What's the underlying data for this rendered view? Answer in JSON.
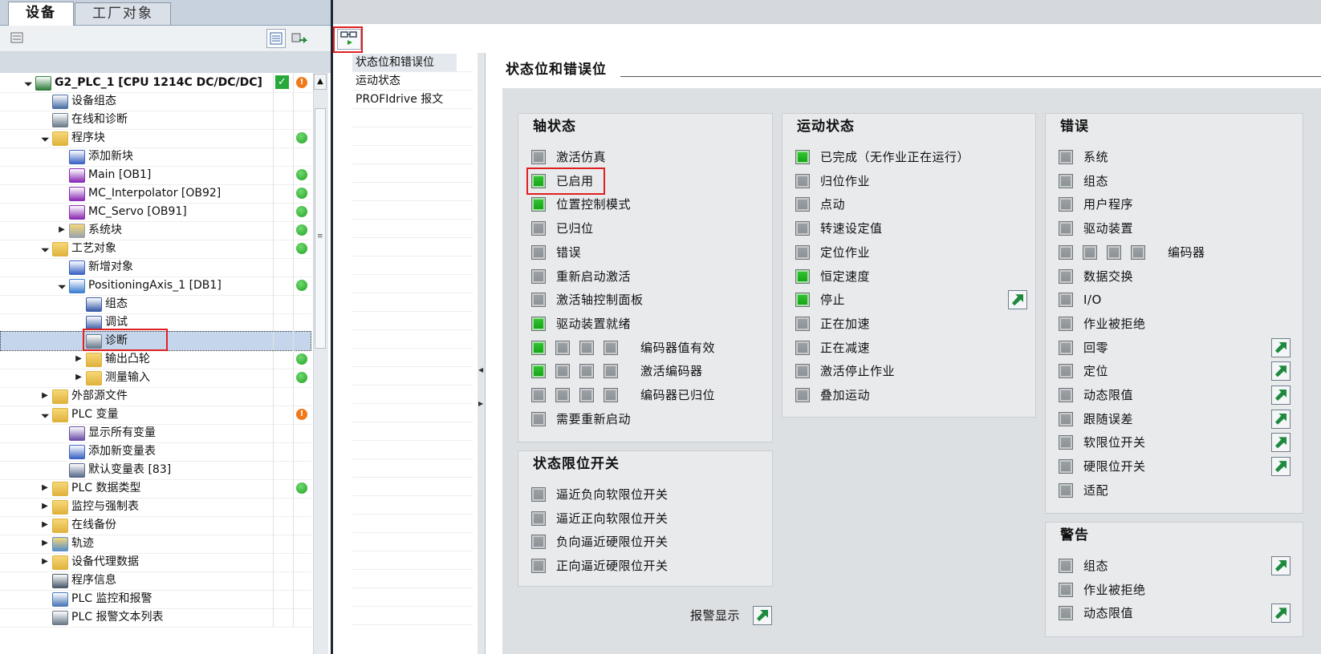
{
  "left_tabs": [
    "设备",
    "工厂对象"
  ],
  "tree": [
    {
      "label": "G2_PLC_1 [CPU 1214C DC/DC/DC]",
      "level": 0,
      "expand": "open",
      "icon": "plc-icon",
      "bold": true,
      "check": true,
      "status": "warn"
    },
    {
      "label": "设备组态",
      "level": 1,
      "expand": "none",
      "icon": "device-config-icon",
      "status": "none"
    },
    {
      "label": "在线和诊断",
      "level": 1,
      "expand": "none",
      "icon": "online-diagnostics-icon",
      "status": "none"
    },
    {
      "label": "程序块",
      "level": 1,
      "expand": "open",
      "icon": "folder-icon",
      "status": "ok"
    },
    {
      "label": "添加新块",
      "level": 2,
      "expand": "none",
      "icon": "add-block-icon",
      "status": "none"
    },
    {
      "label": "Main [OB1]",
      "level": 2,
      "expand": "none",
      "icon": "ob-block-icon",
      "status": "ok"
    },
    {
      "label": "MC_Interpolator [OB92]",
      "level": 2,
      "expand": "none",
      "icon": "ob-block-icon",
      "status": "ok"
    },
    {
      "label": "MC_Servo [OB91]",
      "level": 2,
      "expand": "none",
      "icon": "ob-block-icon",
      "status": "ok"
    },
    {
      "label": "系统块",
      "level": 2,
      "expand": "closed",
      "icon": "system-folder-icon",
      "status": "ok"
    },
    {
      "label": "工艺对象",
      "level": 1,
      "expand": "open",
      "icon": "tech-folder-icon",
      "status": "ok"
    },
    {
      "label": "新增对象",
      "level": 2,
      "expand": "none",
      "icon": "add-object-icon",
      "status": "none"
    },
    {
      "label": "PositioningAxis_1 [DB1]",
      "level": 2,
      "expand": "open",
      "icon": "axis-icon",
      "status": "ok"
    },
    {
      "label": "组态",
      "level": 3,
      "expand": "none",
      "icon": "config-icon",
      "status": "none"
    },
    {
      "label": "调试",
      "level": 3,
      "expand": "none",
      "icon": "commissioning-icon",
      "status": "none"
    },
    {
      "label": "诊断",
      "level": 3,
      "expand": "none",
      "icon": "diagnostics-icon",
      "status": "none",
      "selected": true
    },
    {
      "label": "输出凸轮",
      "level": 3,
      "expand": "closed",
      "icon": "tech-folder-icon",
      "status": "ok"
    },
    {
      "label": "测量输入",
      "level": 3,
      "expand": "closed",
      "icon": "tech-folder-icon",
      "status": "ok"
    },
    {
      "label": "外部源文件",
      "level": 1,
      "expand": "closed",
      "icon": "source-folder-icon",
      "status": "none"
    },
    {
      "label": "PLC 变量",
      "level": 1,
      "expand": "open",
      "icon": "tags-folder-icon",
      "status": "warn"
    },
    {
      "label": "显示所有变量",
      "level": 2,
      "expand": "none",
      "icon": "show-tags-icon",
      "status": "none"
    },
    {
      "label": "添加新变量表",
      "level": 2,
      "expand": "none",
      "icon": "add-tag-table-icon",
      "status": "none"
    },
    {
      "label": "默认变量表 [83]",
      "level": 2,
      "expand": "none",
      "icon": "tag-table-icon",
      "status": "none"
    },
    {
      "label": "PLC 数据类型",
      "level": 1,
      "expand": "closed",
      "icon": "datatype-folder-icon",
      "status": "ok"
    },
    {
      "label": "监控与强制表",
      "level": 1,
      "expand": "closed",
      "icon": "watch-folder-icon",
      "status": "none"
    },
    {
      "label": "在线备份",
      "level": 1,
      "expand": "closed",
      "icon": "backup-folder-icon",
      "status": "none"
    },
    {
      "label": "轨迹",
      "level": 1,
      "expand": "closed",
      "icon": "trace-folder-icon",
      "status": "none"
    },
    {
      "label": "设备代理数据",
      "level": 1,
      "expand": "closed",
      "icon": "proxy-folder-icon",
      "status": "none"
    },
    {
      "label": "程序信息",
      "level": 1,
      "expand": "none",
      "icon": "program-info-icon",
      "status": "none"
    },
    {
      "label": "PLC 监控和报警",
      "level": 1,
      "expand": "none",
      "icon": "alarm-icon",
      "status": "none"
    },
    {
      "label": "PLC 报警文本列表",
      "level": 1,
      "expand": "none",
      "icon": "text-list-icon",
      "status": "none"
    }
  ],
  "nav": [
    {
      "label": "状态位和错误位",
      "active": true
    },
    {
      "label": "运动状态",
      "active": false
    },
    {
      "label": "PROFIdrive 报文",
      "active": false
    }
  ],
  "content_title": "状态位和错误位",
  "groups": {
    "axis_status": {
      "title": "轴状态",
      "rows": [
        {
          "label": "激活仿真",
          "leds": [
            "off"
          ]
        },
        {
          "label": "已启用",
          "leds": [
            "on"
          ]
        },
        {
          "label": "位置控制模式",
          "leds": [
            "on"
          ]
        },
        {
          "label": "已归位",
          "leds": [
            "off"
          ]
        },
        {
          "label": "错误",
          "leds": [
            "off"
          ]
        },
        {
          "label": "重新启动激活",
          "leds": [
            "off"
          ]
        },
        {
          "label": "激活轴控制面板",
          "leds": [
            "off"
          ]
        },
        {
          "label": "驱动装置就绪",
          "leds": [
            "on"
          ]
        },
        {
          "label": "编码器值有效",
          "leds": [
            "on",
            "off",
            "off",
            "off"
          ]
        },
        {
          "label": "激活编码器",
          "leds": [
            "on",
            "off",
            "off",
            "off"
          ]
        },
        {
          "label": "编码器已归位",
          "leds": [
            "off",
            "off",
            "off",
            "off"
          ]
        },
        {
          "label": "需要重新启动",
          "leds": [
            "off"
          ]
        }
      ]
    },
    "limit_switch": {
      "title": "状态限位开关",
      "rows": [
        {
          "label": "逼近负向软限位开关",
          "leds": [
            "off"
          ]
        },
        {
          "label": "逼近正向软限位开关",
          "leds": [
            "off"
          ]
        },
        {
          "label": "负向逼近硬限位开关",
          "leds": [
            "off"
          ]
        },
        {
          "label": "正向逼近硬限位开关",
          "leds": [
            "off"
          ]
        }
      ]
    },
    "motion_status": {
      "title": "运动状态",
      "rows": [
        {
          "label": "已完成（无作业正在运行）",
          "leds": [
            "on"
          ]
        },
        {
          "label": "归位作业",
          "leds": [
            "off"
          ]
        },
        {
          "label": "点动",
          "leds": [
            "off"
          ]
        },
        {
          "label": "转速设定值",
          "leds": [
            "off"
          ]
        },
        {
          "label": "定位作业",
          "leds": [
            "off"
          ]
        },
        {
          "label": "恒定速度",
          "leds": [
            "on"
          ]
        },
        {
          "label": "停止",
          "leds": [
            "on"
          ],
          "jump": true
        },
        {
          "label": "正在加速",
          "leds": [
            "off"
          ]
        },
        {
          "label": "正在减速",
          "leds": [
            "off"
          ]
        },
        {
          "label": "激活停止作业",
          "leds": [
            "off"
          ]
        },
        {
          "label": "叠加运动",
          "leds": [
            "off"
          ]
        }
      ]
    },
    "errors": {
      "title": "错误",
      "rows": [
        {
          "label": "系统",
          "leds": [
            "off"
          ]
        },
        {
          "label": "组态",
          "leds": [
            "off"
          ]
        },
        {
          "label": "用户程序",
          "leds": [
            "off"
          ]
        },
        {
          "label": "驱动装置",
          "leds": [
            "off"
          ]
        },
        {
          "label": "编码器",
          "leds": [
            "off",
            "off",
            "off",
            "off"
          ]
        },
        {
          "label": "数据交换",
          "leds": [
            "off"
          ]
        },
        {
          "label": "I/O",
          "leds": [
            "off"
          ]
        },
        {
          "label": "作业被拒绝",
          "leds": [
            "off"
          ]
        },
        {
          "label": "回零",
          "leds": [
            "off"
          ],
          "jump": true
        },
        {
          "label": "定位",
          "leds": [
            "off"
          ],
          "jump": true
        },
        {
          "label": "动态限值",
          "leds": [
            "off"
          ],
          "jump": true
        },
        {
          "label": "跟随误差",
          "leds": [
            "off"
          ],
          "jump": true
        },
        {
          "label": "软限位开关",
          "leds": [
            "off"
          ],
          "jump": true
        },
        {
          "label": "硬限位开关",
          "leds": [
            "off"
          ],
          "jump": true
        },
        {
          "label": "适配",
          "leds": [
            "off"
          ]
        }
      ]
    },
    "warnings": {
      "title": "警告",
      "rows": [
        {
          "label": "组态",
          "leds": [
            "off"
          ],
          "jump": true
        },
        {
          "label": "作业被拒绝",
          "leds": [
            "off"
          ]
        },
        {
          "label": "动态限值",
          "leds": [
            "off"
          ],
          "jump": true
        }
      ]
    }
  },
  "alarm_display_label": "报警显示",
  "colors": {
    "led_on": "#1aab1a",
    "led_off": "#9a9fa3",
    "highlight": "#e02020",
    "jump_arrow": "#1e8a3e"
  }
}
